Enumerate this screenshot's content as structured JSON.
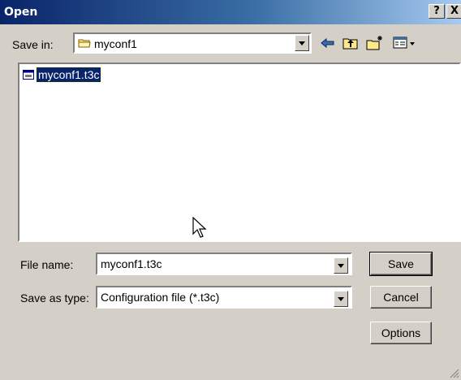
{
  "window": {
    "title": "Open",
    "help_label": "?",
    "close_label": "X"
  },
  "toolbar": {
    "savein_label": "Save in:",
    "folder_name": "myconf1",
    "icons": [
      "back-arrow-icon",
      "up-folder-icon",
      "new-folder-icon",
      "views-menu-icon"
    ]
  },
  "files": [
    {
      "name": "myconf1.t3c",
      "selected": true
    }
  ],
  "fields": {
    "filename_label": "File name:",
    "filename_value": "myconf1.t3c",
    "filetype_label": "Save as type:",
    "filetype_value": "Configuration file (*.t3c)"
  },
  "buttons": {
    "save": "Save",
    "cancel": "Cancel",
    "options": "Options"
  },
  "colors": {
    "titlebar_start": "#0a246a",
    "selection": "#0a246a",
    "face": "#d4d0c8"
  }
}
